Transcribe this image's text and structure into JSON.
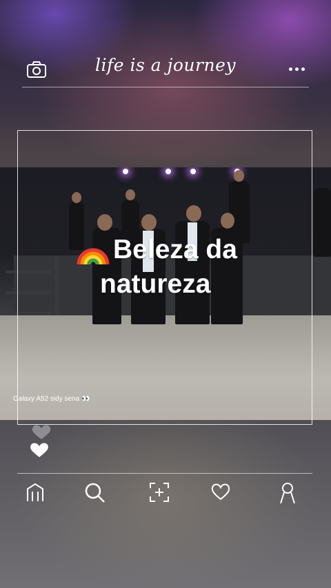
{
  "header": {
    "title": "life is a journey",
    "camera_icon": "camera-icon",
    "more_icon": "more-dots-icon"
  },
  "post": {
    "caption_line1": "Beleza da",
    "caption_line2": "natureza",
    "caption_emoji": "rainbow-icon",
    "watermark": "Galaxy A52 sidy sena 👀"
  },
  "likes_icon": "heart-icon",
  "bottom_nav": [
    {
      "icon": "home-icon"
    },
    {
      "icon": "search-icon"
    },
    {
      "icon": "add-post-icon"
    },
    {
      "icon": "heart-icon"
    },
    {
      "icon": "profile-icon"
    }
  ],
  "colors": {
    "overlay_line": "#ffffff",
    "background": "#4f4d53"
  }
}
